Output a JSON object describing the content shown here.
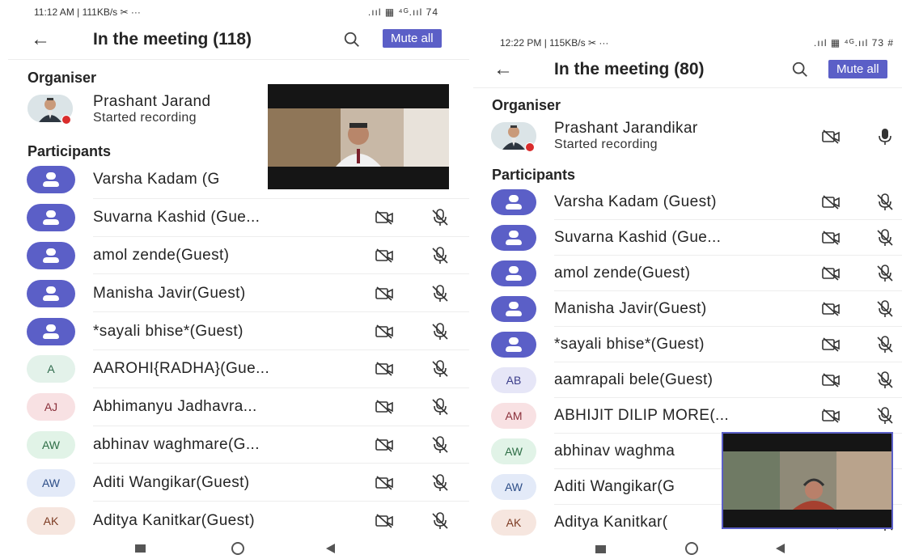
{
  "left": {
    "status": {
      "time": "11:12 AM | 111KB/s ✂ ···",
      "signal": ".ııl ▦ ⁴ᴳ.ııl 74"
    },
    "header": {
      "title": "In the meeting (118)",
      "mute_all": "Mute all"
    },
    "organiser_label": "Organiser",
    "organiser": {
      "name": "Prashant Jarand",
      "status": "Started recording"
    },
    "participants_label": "Participants",
    "participants": [
      {
        "name": "Varsha Kadam (G",
        "avatar": "person",
        "color": "#5b5fc7"
      },
      {
        "name": "Suvarna Kashid (Gue...",
        "avatar": "person",
        "color": "#5b5fc7"
      },
      {
        "name": "amol zende(Guest)",
        "avatar": "person",
        "color": "#5b5fc7"
      },
      {
        "name": "Manisha Javir(Guest)",
        "avatar": "person",
        "color": "#5b5fc7"
      },
      {
        "name": "*sayali bhise*(Guest)",
        "avatar": "person",
        "color": "#5b5fc7"
      },
      {
        "name": "AAROHI{RADHA}(Gue...",
        "initials": "A",
        "bg": "#e3f2ea",
        "fg": "#2f6b4d"
      },
      {
        "name": "Abhimanyu Jadhavra...",
        "initials": "AJ",
        "bg": "#f8e1e3",
        "fg": "#8a2f3a"
      },
      {
        "name": "abhinav waghmare(G...",
        "initials": "AW",
        "bg": "#e1f3e7",
        "fg": "#2d6d45"
      },
      {
        "name": "Aditi Wangikar(Guest)",
        "initials": "AW",
        "bg": "#e3eaf8",
        "fg": "#2c4d87"
      },
      {
        "name": "Aditya Kanitkar(Guest)",
        "initials": "AK",
        "bg": "#f6e6df",
        "fg": "#7c3a22"
      }
    ]
  },
  "right": {
    "status": {
      "time": "12:22 PM | 115KB/s ✂ ···",
      "signal": ".ııl ▦ ⁴ᴳ.ııl 73 #"
    },
    "header": {
      "title": "In the meeting (80)",
      "mute_all": "Mute all"
    },
    "organiser_label": "Organiser",
    "organiser": {
      "name": "Prashant Jarandikar",
      "status": "Started recording"
    },
    "participants_label": "Participants",
    "participants": [
      {
        "name": "Varsha Kadam (Guest)",
        "avatar": "person",
        "color": "#5b5fc7"
      },
      {
        "name": "Suvarna Kashid (Gue...",
        "avatar": "person",
        "color": "#5b5fc7"
      },
      {
        "name": "amol zende(Guest)",
        "avatar": "person",
        "color": "#5b5fc7"
      },
      {
        "name": "Manisha Javir(Guest)",
        "avatar": "person",
        "color": "#5b5fc7"
      },
      {
        "name": "*sayali bhise*(Guest)",
        "avatar": "person",
        "color": "#5b5fc7"
      },
      {
        "name": "aamrapali bele(Guest)",
        "initials": "AB",
        "bg": "#e6e6f7",
        "fg": "#3b3d8a"
      },
      {
        "name": "ABHIJIT DILIP MORE(...",
        "initials": "AM",
        "bg": "#f8e1e3",
        "fg": "#8a2f3a"
      },
      {
        "name": "abhinav waghma",
        "initials": "AW",
        "bg": "#e1f3e7",
        "fg": "#2d6d45"
      },
      {
        "name": "Aditi Wangikar(G",
        "initials": "AW",
        "bg": "#e3eaf8",
        "fg": "#2c4d87"
      },
      {
        "name": "Aditya Kanitkar(",
        "initials": "AK",
        "bg": "#f6e6df",
        "fg": "#7c3a22"
      }
    ]
  },
  "colors": {
    "accent": "#5b5fc7",
    "recording": "#d92c2c"
  },
  "icons": {
    "back": "back-arrow-icon",
    "search": "search-icon",
    "camera_off": "camera-off-icon",
    "mic_off": "mic-off-icon",
    "mic": "mic-icon"
  }
}
